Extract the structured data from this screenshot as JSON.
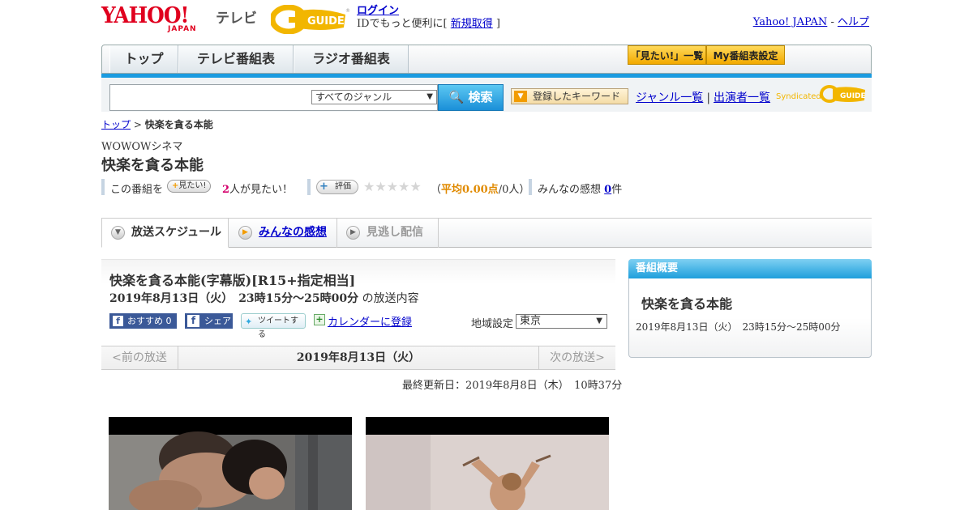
{
  "header": {
    "yahoo_logo": "YAHOO!",
    "yahoo_logo_sub": "JAPAN",
    "tv_label": "テレビ",
    "gguide_logo": "G-GUIDE",
    "login_link": "ログイン",
    "login_prefix": "IDでもっと便利に[ ",
    "signup_link": "新規取得",
    "login_suffix": " ]",
    "yahoo_japan_link": "Yahoo! JAPAN",
    "separator": " - ",
    "help_link": "ヘルプ"
  },
  "nav": {
    "tabs": [
      {
        "label": "トップ"
      },
      {
        "label": "テレビ番組表"
      },
      {
        "label": "ラジオ番組表"
      }
    ],
    "mitai_list": "「見たい!」一覧",
    "my_schedule": "My番組表設定"
  },
  "search": {
    "placeholder": "",
    "genre_selected": "すべてのジャンル",
    "search_button": "検索",
    "keyword_button": "登録したキーワード",
    "genre_list_link": "ジャンル一覧",
    "link_separator": "|",
    "cast_list_link": "出演者一覧",
    "syndicated_label": "Syndicated",
    "syndicated_logo": "G-GUIDE"
  },
  "breadcrumb": {
    "top_link": "トップ",
    "separator": " > ",
    "current": "快楽を貪る本能"
  },
  "program": {
    "channel": "WOWOWシネマ",
    "title": "快楽を貪る本能",
    "stats": {
      "prefix": "この番組を",
      "mitai_button": "見たい!",
      "mitai_count": "2",
      "mitai_suffix": "人が見たい！",
      "rating_button": "評価",
      "stars": "★★★★★",
      "avg_open": "（",
      "avg_value": "平均0.00点",
      "avg_people": "/0人）",
      "reviews_label": "みんなの感想",
      "reviews_count": "0",
      "reviews_suffix": "件"
    }
  },
  "tabs": {
    "schedule": "放送スケジュール",
    "reviews": "みんなの感想",
    "missed": "見逃し配信"
  },
  "broadcast": {
    "full_title": "快楽を貪る本能(字幕版)[R15+指定相当]",
    "date_time": "2019年8月13日（火）　23時15分～25時00分",
    "date_time_suffix": " の放送内容",
    "share_recommend": "おすすめ 0",
    "share_facebook": "シェア",
    "share_tweet": "ツイートする",
    "calendar_link": "カレンダーに登録",
    "region_label": "地域設定",
    "region_selected": "東京",
    "prev": "<前の放送",
    "current_date": "2019年8月13日（火）",
    "next": "次の放送>",
    "last_updated": "最終更新日：2019年8月8日（木）　10時37分"
  },
  "sidebar": {
    "header": "番組概要",
    "title": "快楽を貪る本能",
    "date_time": "2019年8月13日（火）　23時15分～25時00分"
  },
  "colors": {
    "accent_blue": "#1a9be0",
    "yahoo_red": "#e0001e",
    "gguide_yellow": "#f2a900",
    "link": "#0000cc"
  }
}
